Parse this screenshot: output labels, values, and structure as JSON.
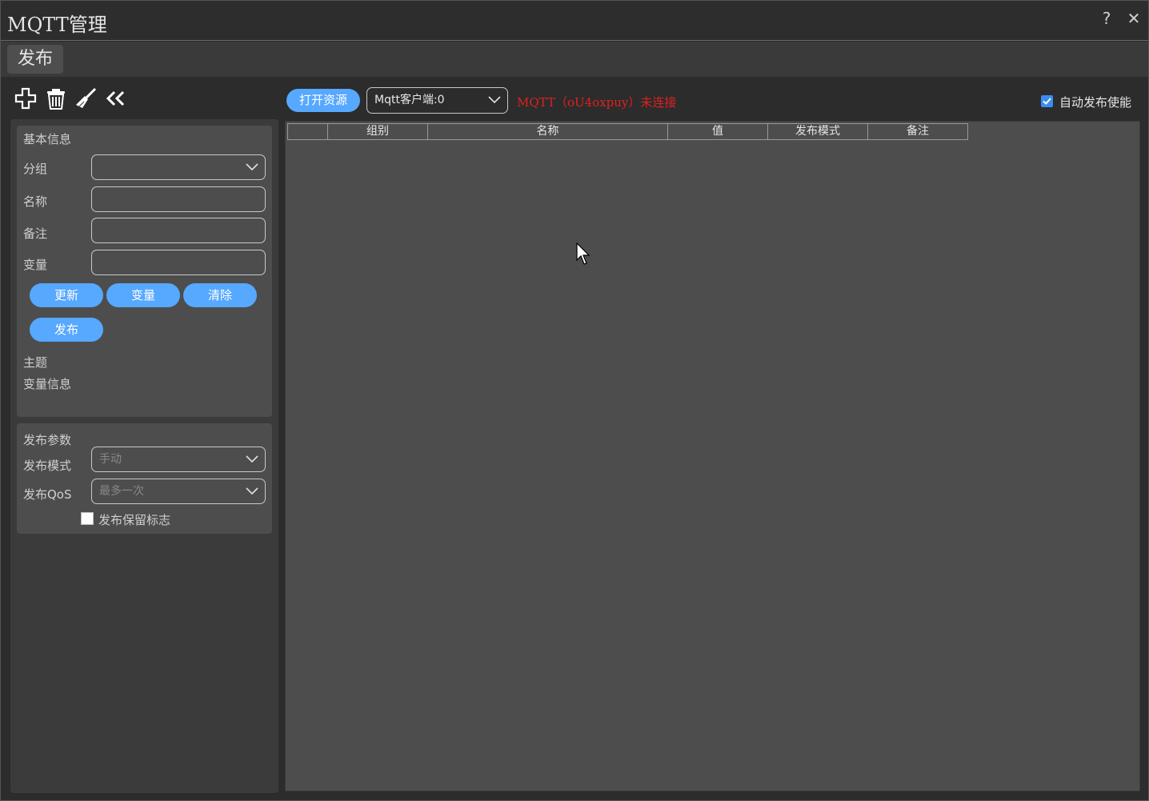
{
  "window": {
    "title": "MQTT管理",
    "help_label": "?",
    "close_label": "✕"
  },
  "tabs": [
    {
      "label": "发布"
    }
  ],
  "toolbar": {
    "icons": [
      "add-icon",
      "delete-icon",
      "broom-clear-icon",
      "collapse-icon"
    ]
  },
  "basic_info": {
    "title": "基本信息",
    "group_label": "分组",
    "group_value": "",
    "name_label": "名称",
    "name_value": "",
    "remark_label": "备注",
    "remark_value": "",
    "variable_label": "变量",
    "variable_value": "",
    "buttons": {
      "update": "更新",
      "variable": "变量",
      "clear": "清除",
      "publish": "发布"
    },
    "topic_label": "主题",
    "variable_info_label": "变量信息"
  },
  "publish_params": {
    "title": "发布参数",
    "mode_label": "发布模式",
    "mode_value": "手动",
    "qos_label": "发布QoS",
    "qos_value": "最多一次",
    "retain_label": "发布保留标志",
    "retain_checked": false
  },
  "main": {
    "open_resource_label": "打开资源",
    "client_select_value": "Mqtt客户端:0",
    "status_text": "MQTT（oU4oxpuy）未连接",
    "status_color": "#e02020",
    "auto_publish_label": "自动发布使能",
    "auto_publish_checked": true,
    "table_columns": [
      "",
      "组别",
      "名称",
      "值",
      "发布模式",
      "备注"
    ],
    "table_rows": []
  },
  "colors": {
    "accent": "#57a8ff",
    "checkbox": "#3b8cf0"
  }
}
